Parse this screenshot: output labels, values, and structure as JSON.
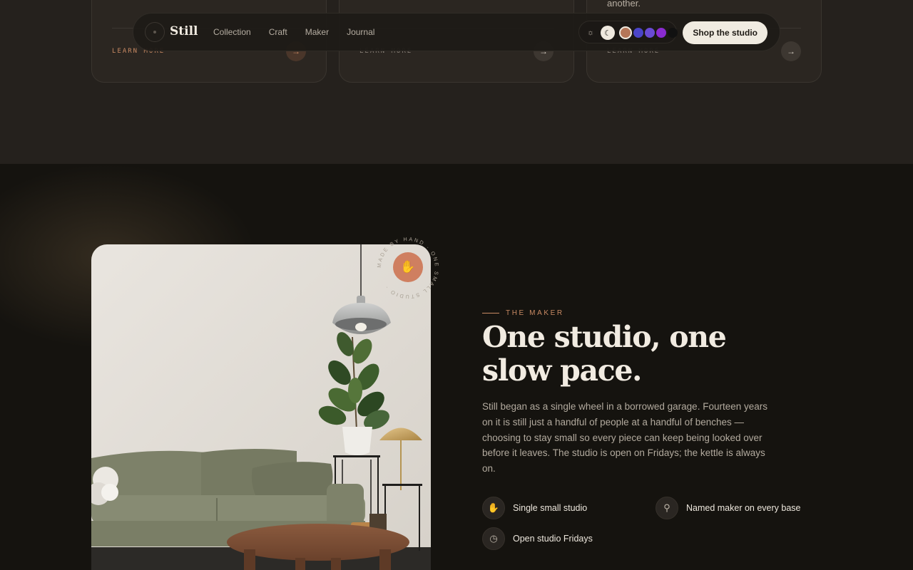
{
  "cards": [
    {
      "text": "",
      "cta": "LEARN MORE",
      "arrow": "→"
    },
    {
      "text": "",
      "cta": "LEARN MORE",
      "arrow": "→"
    },
    {
      "text": "another.",
      "cta": "LEARN MORE",
      "arrow": "→"
    }
  ],
  "nav": {
    "brand": "Still",
    "links": [
      "Collection",
      "Craft",
      "Maker",
      "Journal"
    ],
    "theme_icons": {
      "light": "sun-icon",
      "dark": "moon-icon"
    },
    "swatches": [
      "#b57658",
      "#4b45c8",
      "#6a4bd4",
      "#8a2bd0",
      "#111111"
    ],
    "cta": "Shop the studio"
  },
  "maker": {
    "badge_text": "MADE BY HAND · ONE SMALL STUDIO · ",
    "eyebrow": "THE MAKER",
    "headline": "One studio, one slow pace.",
    "body": "Still began as a single wheel in a borrowed garage. Fourteen years on it is still just a handful of people at a handful of benches — choosing to stay small so every piece can keep being looked over before it leaves. The studio is open on Fridays; the kettle is always on.",
    "features": [
      {
        "icon": "hand-icon",
        "label": "Single small studio"
      },
      {
        "icon": "map-pin-icon",
        "label": "Named maker on every base"
      },
      {
        "icon": "clock-icon",
        "label": "Open studio Fridays"
      }
    ]
  },
  "colors": {
    "accent": "#c98a63",
    "background": "#15130f",
    "band": "#25211d"
  }
}
